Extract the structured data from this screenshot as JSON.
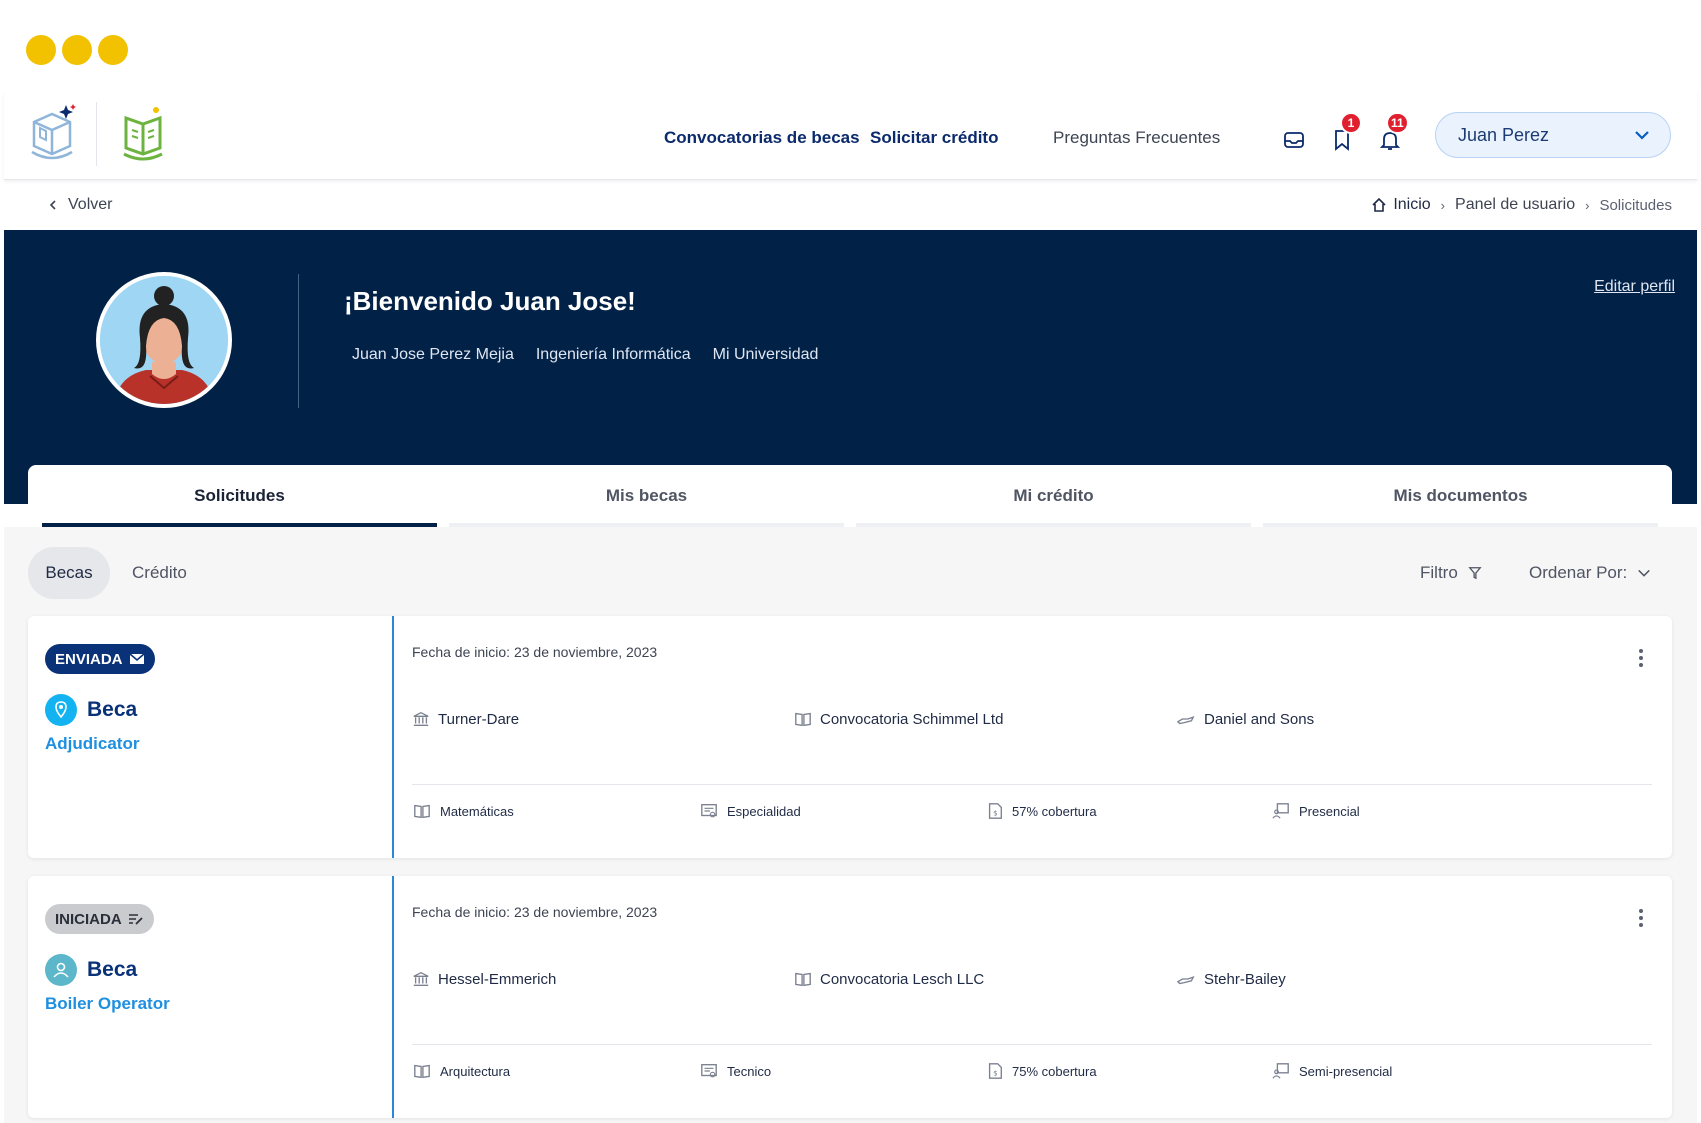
{
  "nav": {
    "links": [
      "Convocatorias de becas",
      "Solicitar crédito",
      "Preguntas Frecuentes"
    ],
    "saved_badge": "1",
    "notifications_badge": "11",
    "user_name": "Juan Perez"
  },
  "breadcrumb": {
    "back": "Volver",
    "home": "Inicio",
    "panel": "Panel de usuario",
    "current": "Solicitudes"
  },
  "hero": {
    "title": "¡Bienvenido Juan Jose!",
    "full_name": "Juan Jose Perez Mejia",
    "career": "Ingeniería Informática",
    "university": "Mi Universidad",
    "edit_profile": "Editar perfil"
  },
  "tabs": [
    {
      "label": "Solicitudes",
      "active": true
    },
    {
      "label": "Mis becas",
      "active": false
    },
    {
      "label": "Mi crédito",
      "active": false
    },
    {
      "label": "Mis documentos",
      "active": false
    }
  ],
  "toolbar": {
    "becas": "Becas",
    "credito": "Crédito",
    "filter": "Filtro",
    "sort": "Ordenar Por:"
  },
  "applications": [
    {
      "status": "ENVIADA",
      "status_kind": "sent",
      "label": "Beca",
      "type": "Adjudicator",
      "date": "Fecha de inicio: 23 de noviembre, 2023",
      "institution": "Turner-Dare",
      "call": "Convocatoria Schimmel Ltd",
      "sponsor": "Daniel and Sons",
      "field": "Matemáticas",
      "level": "Especialidad",
      "coverage": "57% cobertura",
      "modality": "Presencial"
    },
    {
      "status": "INICIADA",
      "status_kind": "started",
      "label": "Beca",
      "type": "Boiler Operator",
      "date": "Fecha de inicio: 23 de noviembre, 2023",
      "institution": "Hessel-Emmerich",
      "call": "Convocatoria Lesch LLC",
      "sponsor": "Stehr-Bailey",
      "field": "Arquitectura",
      "level": "Tecnico",
      "coverage": "75% cobertura",
      "modality": "Semi-presencial"
    }
  ],
  "colors": {
    "hero_bg": "#012147",
    "primary": "#0a3278",
    "accent_blue": "#1f8fe0",
    "window_dot": "#f2c200",
    "badge_red": "#e0202e"
  }
}
